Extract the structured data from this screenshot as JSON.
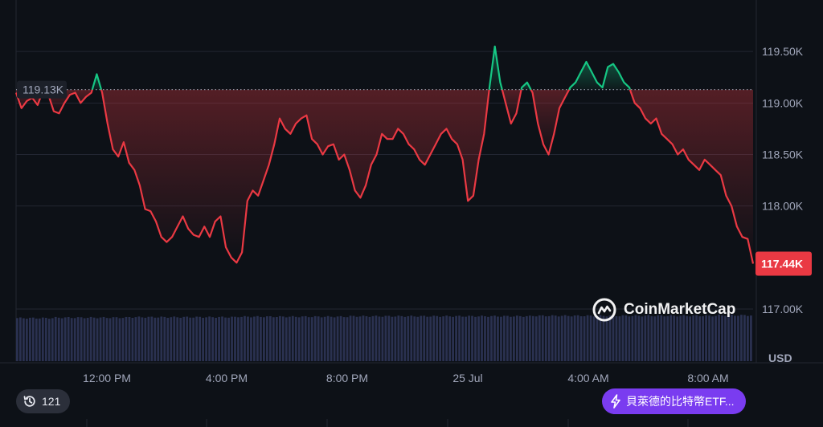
{
  "chart_data": {
    "type": "line",
    "x_ticks": [
      "12:00 PM",
      "4:00 PM",
      "8:00 PM",
      "25 Jul",
      "4:00 AM",
      "8:00 AM"
    ],
    "y_ticks": [
      "119.50K",
      "119.00K",
      "118.50K",
      "118.00K",
      "117.44K",
      "117.00K"
    ],
    "y_unit": "USD",
    "ylim": [
      117000,
      120000
    ],
    "reference_value": 119130,
    "reference_label": "119.13K",
    "last_value": 117440,
    "last_label": "117.44K",
    "series": [
      {
        "values": [
          119100,
          118950,
          119020,
          119050,
          118980,
          119120,
          119080,
          118920,
          118900,
          119000,
          119080,
          119100,
          119000,
          119060,
          119100,
          119280,
          119100,
          118800,
          118550,
          118480,
          118620,
          118420,
          118350,
          118200,
          117970,
          117950,
          117850,
          117700,
          117650,
          117700,
          117800,
          117900,
          117780,
          117720,
          117700,
          117800,
          117700,
          117850,
          117900,
          117600,
          117500,
          117450,
          117550,
          118050,
          118150,
          118100,
          118250,
          118400,
          118600,
          118850,
          118750,
          118700,
          118800,
          118850,
          118880,
          118650,
          118600,
          118500,
          118580,
          118600,
          118450,
          118500,
          118350,
          118150,
          118080,
          118200,
          118400,
          118500,
          118700,
          118650,
          118650,
          118750,
          118700,
          118600,
          118550,
          118450,
          118400,
          118500,
          118600,
          118700,
          118750,
          118650,
          118600,
          118450,
          118050,
          118100,
          118450,
          118700,
          119150,
          119550,
          119200,
          119000,
          118800,
          118900,
          119150,
          119200,
          119100,
          118800,
          118600,
          118500,
          118700,
          118950,
          119050,
          119150,
          119200,
          119300,
          119400,
          119300,
          119200,
          119150,
          119350,
          119380,
          119300,
          119200,
          119150,
          119000,
          118950,
          118850,
          118800,
          118850,
          118700,
          118650,
          118600,
          118500,
          118550,
          118450,
          118400,
          118350,
          118450,
          118400,
          118350,
          118300,
          118100,
          118000,
          117800,
          117700,
          117680,
          117440
        ],
        "volume": [
          0.94,
          0.95,
          0.95,
          0.96,
          0.96,
          0.96,
          0.97,
          0.97,
          0.97,
          0.98,
          0.98,
          0.98,
          0.98,
          0.98,
          0.99,
          0.99,
          0.99,
          0.99,
          0.99,
          1.0
        ]
      }
    ],
    "watermark": "CoinMarketCap"
  },
  "controls": {
    "history_count": "121",
    "news_label": "貝萊德的比特幣ETF..."
  },
  "colors": {
    "background": "#0d1117",
    "up": "#16c784",
    "down": "#ea3943",
    "grid": "#222632",
    "volume": "#2a3150",
    "reference": "#8a8f9c"
  }
}
